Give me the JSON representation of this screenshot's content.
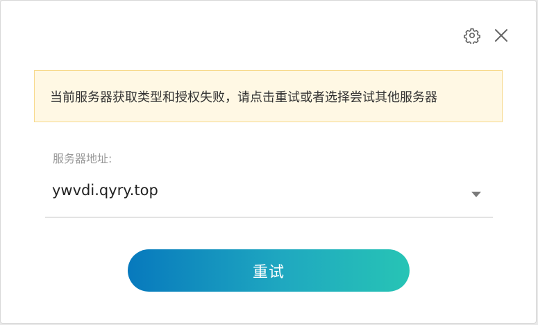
{
  "alert": {
    "message": "当前服务器获取类型和授权失败，请点击重试或者选择尝试其他服务器",
    "background": "#fff8e4",
    "border": "#f7d98b"
  },
  "server_field": {
    "label": "服务器地址:",
    "selected_value": "ywvdi.qyry.top"
  },
  "actions": {
    "retry_label": "重试",
    "accent_gradient": [
      "#0779bd",
      "#27c4b5"
    ]
  },
  "header_icons": [
    "gear-icon",
    "close-icon"
  ]
}
